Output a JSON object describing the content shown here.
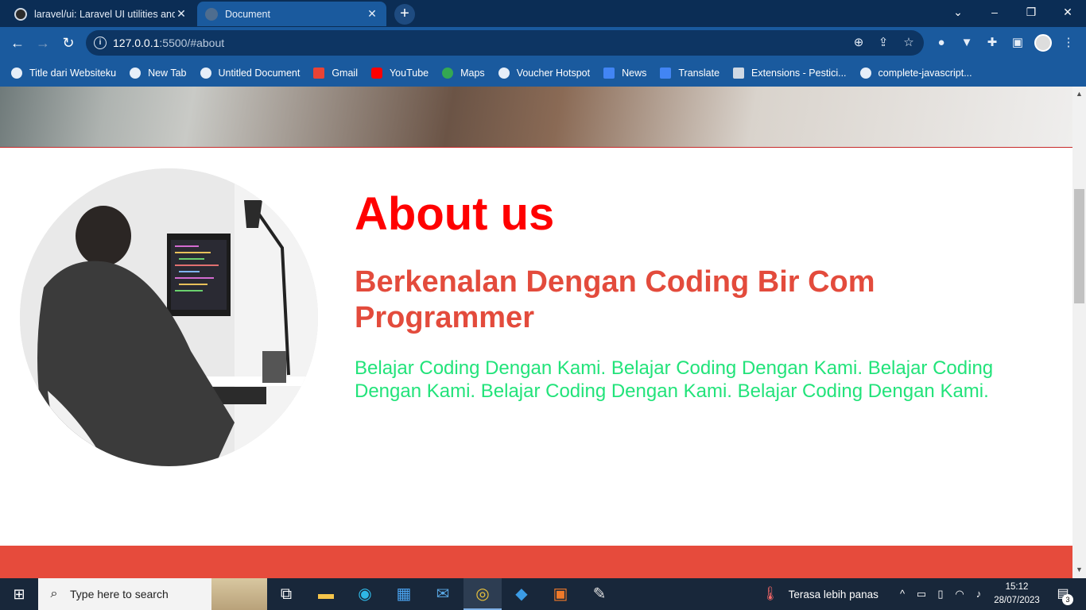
{
  "browser": {
    "tabs": [
      {
        "title": "laravel/ui: Laravel UI utilities and",
        "icon": "github-icon",
        "active": false
      },
      {
        "title": "Document",
        "icon": "globe-icon",
        "active": true
      }
    ],
    "url_host": "127.0.0.1",
    "url_rest": ":5500/#about",
    "bookmarks": [
      {
        "label": "Title dari Websiteku",
        "icon": "globe-icon",
        "color": "#e6eef8"
      },
      {
        "label": "New Tab",
        "icon": "globe-icon",
        "color": "#e6eef8"
      },
      {
        "label": "Untitled Document",
        "icon": "globe-icon",
        "color": "#e6eef8"
      },
      {
        "label": "Gmail",
        "icon": "gmail-icon",
        "color": "#ea4335"
      },
      {
        "label": "YouTube",
        "icon": "youtube-icon",
        "color": "#ff0000"
      },
      {
        "label": "Maps",
        "icon": "maps-icon",
        "color": "#34a853"
      },
      {
        "label": "Voucher Hotspot",
        "icon": "globe-icon",
        "color": "#e6eef8"
      },
      {
        "label": "News",
        "icon": "news-icon",
        "color": "#4285f4"
      },
      {
        "label": "Translate",
        "icon": "translate-icon",
        "color": "#4285f4"
      },
      {
        "label": "Extensions - Pestici...",
        "icon": "puzzle-icon",
        "color": "#e6eef8"
      },
      {
        "label": "complete-javascript...",
        "icon": "github-icon",
        "color": "#e6eef8"
      }
    ]
  },
  "about": {
    "title": "About us",
    "subtitle": "Berkenalan Dengan Coding Bir Com Programmer",
    "description": "Belajar Coding Dengan Kami. Belajar Coding Dengan Kami. Belajar Coding Dengan Kami. Belajar Coding Dengan Kami. Belajar Coding Dengan Kami.",
    "colors": {
      "title": "#ff0000",
      "subtitle": "#e34b3c",
      "description": "#22e37a",
      "footer": "#e64b3c"
    }
  },
  "taskbar": {
    "search_placeholder": "Type here to search",
    "weather_text": "Terasa lebih panas",
    "time": "15:12",
    "date": "28/07/2023",
    "notification_count": "3"
  }
}
